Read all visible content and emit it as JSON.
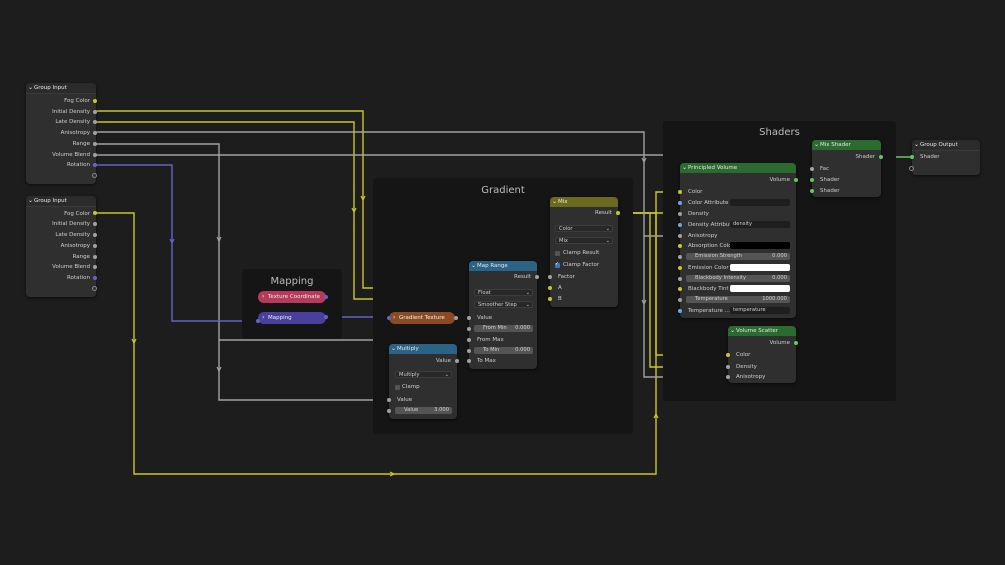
{
  "frames": {
    "gradient": "Gradient",
    "shaders": "Shaders",
    "mapping": "Mapping"
  },
  "group_input_1": {
    "title": "Group Input",
    "outputs": [
      "Fog Color",
      "Initial Density",
      "Late Density",
      "Anisotropy",
      "Range",
      "Volume Blend",
      "Rotation"
    ]
  },
  "group_input_2": {
    "title": "Group Input",
    "outputs": [
      "Fog Color",
      "Initial Density",
      "Late Density",
      "Anisotropy",
      "Range",
      "Volume Blend",
      "Rotation"
    ]
  },
  "texture_coordinate": {
    "title": "Texture Coordinate"
  },
  "mapping": {
    "title": "Mapping"
  },
  "gradient_texture": {
    "title": "Gradient Texture"
  },
  "multiply": {
    "title": "Multiply",
    "output": "Value",
    "operation": "Multiply",
    "clamp": "Clamp",
    "input": "Value",
    "value_label": "Value",
    "value": "3.000"
  },
  "map_range": {
    "title": "Map Range",
    "output": "Result",
    "type": "Float",
    "interpolation": "Smoother Step",
    "inputs": {
      "value": "Value",
      "from_max": "From Max",
      "to_max": "To Max"
    },
    "from_min_label": "From Min",
    "from_min": "0.000",
    "to_min_label": "To Min",
    "to_min": "0.000"
  },
  "mix": {
    "title": "Mix",
    "output": "Result",
    "data_type": "Color",
    "blend": "Mix",
    "clamp_result": "Clamp Result",
    "clamp_factor": "Clamp Factor",
    "inputs": [
      "Factor",
      "A",
      "B"
    ]
  },
  "principled_volume": {
    "title": "Principled Volume",
    "output": "Volume",
    "color": "Color",
    "color_attribute": "Color Attribute",
    "density": "Density",
    "density_attribute": "Density Attribute",
    "density_attribute_value": "density",
    "anisotropy": "Anisotropy",
    "absorption_color": "Absorption Color",
    "emission_strength": "Emission Strength",
    "emission_strength_value": "0.000",
    "emission_color": "Emission Color",
    "blackbody_intensity": "Blackbody Intensity",
    "blackbody_intensity_value": "0.000",
    "blackbody_tint": "Blackbody Tint",
    "temperature": "Temperature",
    "temperature_value": "1000.000",
    "temperature_attr": "Temperature ...",
    "temperature_attr_value": "temperature"
  },
  "volume_scatter": {
    "title": "Volume Scatter",
    "output": "Volume",
    "inputs": [
      "Color",
      "Density",
      "Anisotropy"
    ]
  },
  "mix_shader": {
    "title": "Mix Shader",
    "output": "Shader",
    "inputs": [
      "Fac",
      "Shader",
      "Shader"
    ]
  },
  "group_output": {
    "title": "Group Output",
    "input": "Shader"
  },
  "colors": {
    "float": "#a1a1a1",
    "color": "#c7c729",
    "vector": "#6363c7",
    "shader": "#63c763"
  }
}
